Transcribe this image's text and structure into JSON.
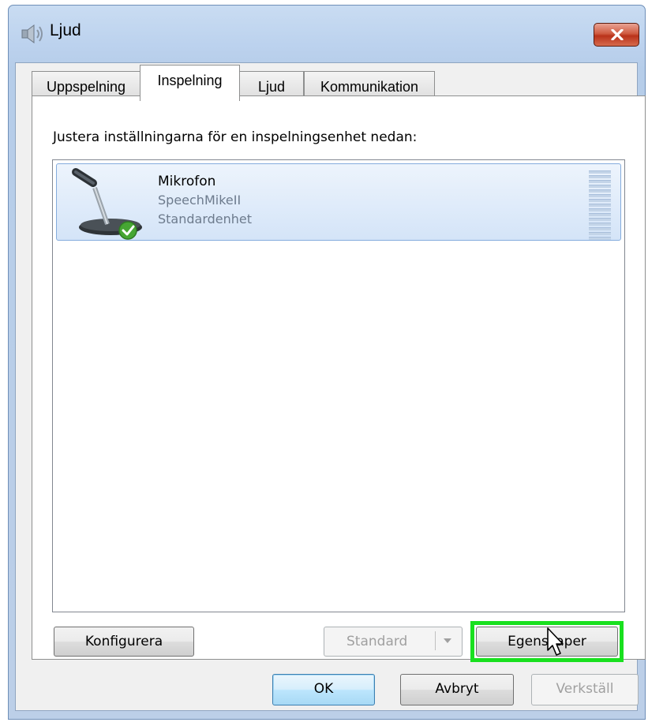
{
  "window": {
    "title": "Ljud",
    "title_icon": "speaker-icon",
    "close_icon": "close-icon"
  },
  "tabs": [
    {
      "label": "Uppspelning",
      "active": false
    },
    {
      "label": "Inspelning",
      "active": true
    },
    {
      "label": "Ljud",
      "active": false
    },
    {
      "label": "Kommunikation",
      "active": false
    }
  ],
  "recording": {
    "instruction": "Justera inställningarna för en inspelningsenhet nedan:",
    "devices": [
      {
        "name": "Mikrofon",
        "description": "SpeechMikeII",
        "status": "Standardenhet",
        "icon": "microphone-icon",
        "badge_icon": "default-check-icon",
        "selected": true
      }
    ]
  },
  "panel_buttons": {
    "configure": "Konfigurera",
    "set_default": "Standard",
    "properties": "Egenskaper"
  },
  "dialog_buttons": {
    "ok": "OK",
    "cancel": "Avbryt",
    "apply": "Verkställ"
  },
  "colors": {
    "highlight": "#19e01f",
    "selection": "#d4e4f8",
    "close_button": "#c7472c"
  }
}
